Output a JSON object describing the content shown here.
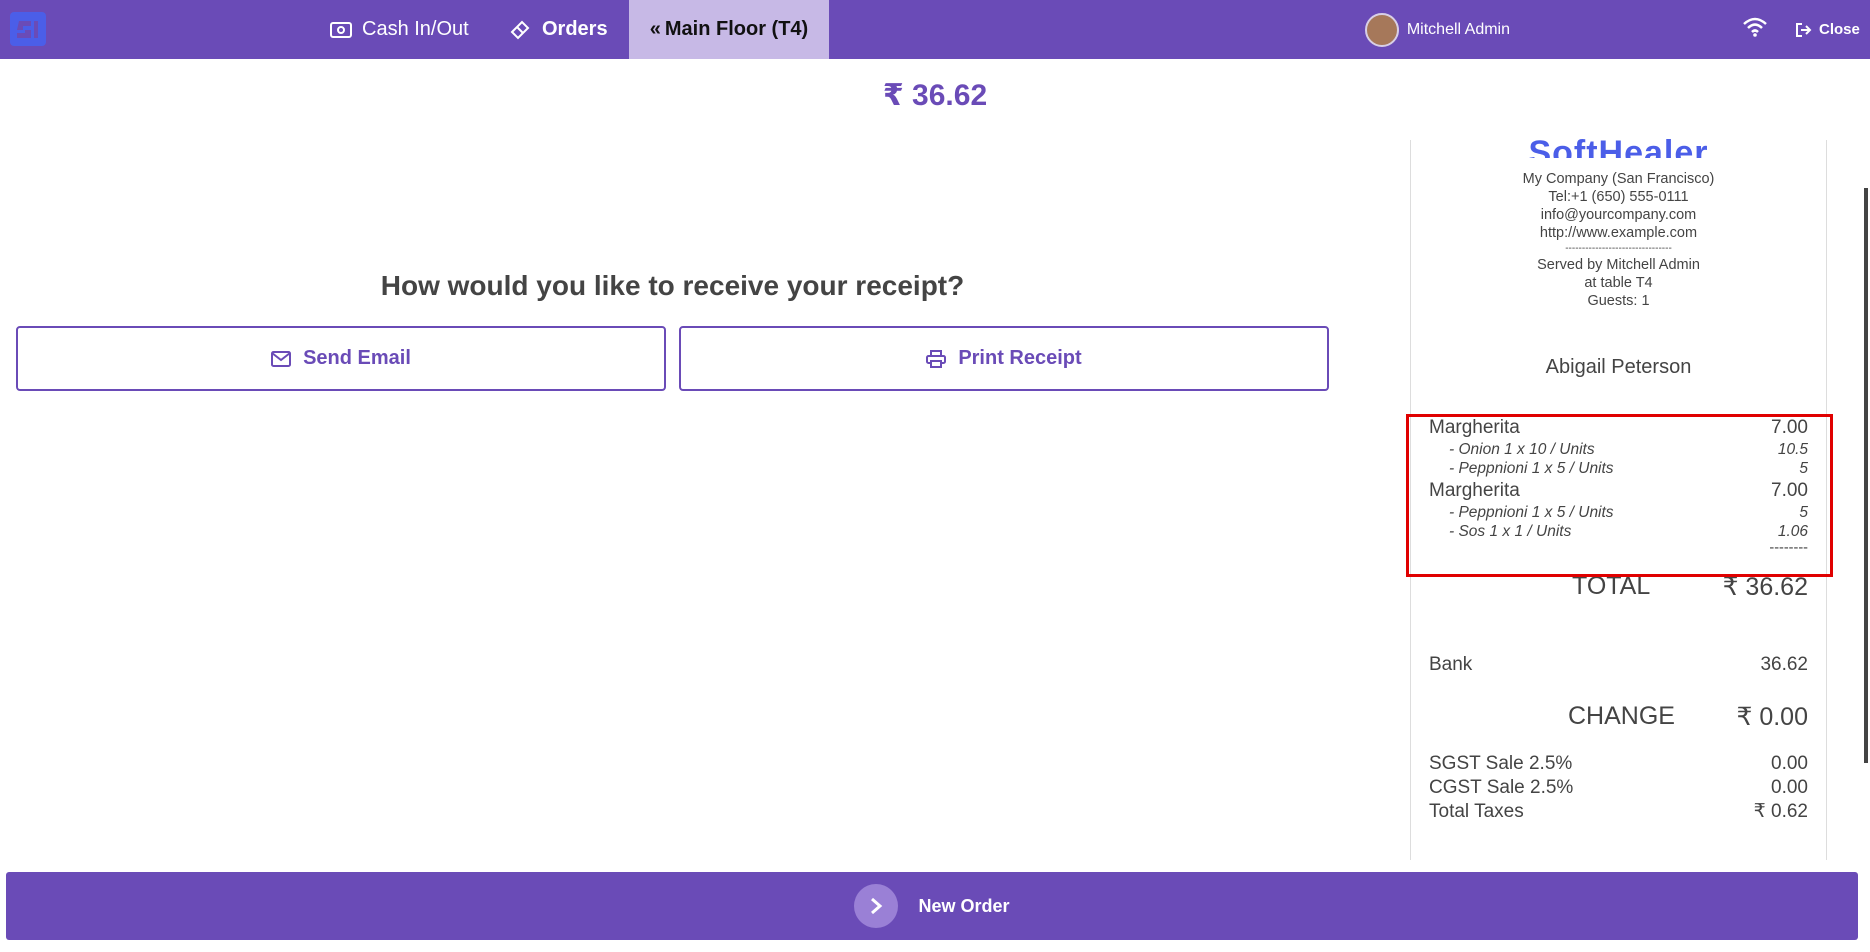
{
  "topbar": {
    "cash_label": "Cash In/Out",
    "orders_label": "Orders",
    "floor_label": "Main Floor (T4)",
    "user_name": "Mitchell Admin",
    "close_label": "Close"
  },
  "payment": {
    "amount": "₹ 36.62",
    "question": "How would you like to receive your receipt?",
    "email_button": "Send Email",
    "print_button": "Print Receipt"
  },
  "receipt": {
    "logo_text": "SoftHealer",
    "company": "My Company (San Francisco)",
    "tel": "Tel:+1 (650) 555-0111",
    "email": "info@yourcompany.com",
    "website": "http://www.example.com",
    "separator": "--------------------------------",
    "served_by": "Served by Mitchell Admin",
    "table": "at table T4",
    "guests": "Guests: 1",
    "customer": "Abigail Peterson",
    "lines": [
      {
        "name": "Margherita",
        "price": "7.00"
      },
      {
        "name": "- Onion 1 x 10 / Units",
        "price": "10.5"
      },
      {
        "name": "- Peppnioni 1 x 5 / Units",
        "price": "5"
      },
      {
        "name": "Margherita",
        "price": "7.00"
      },
      {
        "name": "- Peppnioni 1 x 5 / Units",
        "price": "5"
      },
      {
        "name": "- Sos 1 x 1 / Units",
        "price": "1.06"
      }
    ],
    "line_dashes": "--------",
    "total_label": "TOTAL",
    "total_value": "₹ 36.62",
    "bank_label": "Bank",
    "bank_value": "36.62",
    "change_label": "CHANGE",
    "change_value": "₹ 0.00",
    "taxes": [
      {
        "label": "SGST Sale 2.5%",
        "value": "0.00"
      },
      {
        "label": "CGST Sale 2.5%",
        "value": "0.00"
      },
      {
        "label": "Total Taxes",
        "value": "₹ 0.62"
      }
    ]
  },
  "bottom": {
    "new_order_label": "New Order"
  },
  "colors": {
    "brand": "#6a4bb7",
    "active_tab": "#c7b9e6",
    "highlight": "#e00000"
  }
}
